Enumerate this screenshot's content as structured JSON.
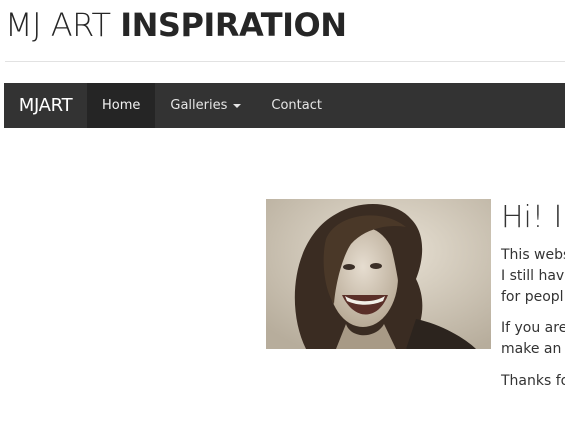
{
  "site_title": {
    "light": "MJ ART",
    "bold": "INSPIRATION"
  },
  "navbar": {
    "brand": "MJART",
    "items": [
      {
        "label": "Home",
        "active": true
      },
      {
        "label": "Galleries",
        "dropdown": true
      },
      {
        "label": "Contact"
      }
    ]
  },
  "intro": {
    "heading": "Hi! I'r",
    "paragraph1": [
      "This webs",
      "I still have",
      "for peopl"
    ],
    "paragraph2": [
      "If you are",
      "make an"
    ],
    "paragraph3": "Thanks fo",
    "photo_icon": "portrait-photo"
  },
  "colors": {
    "navbar_bg": "#333333",
    "active_bg": "#252525"
  }
}
